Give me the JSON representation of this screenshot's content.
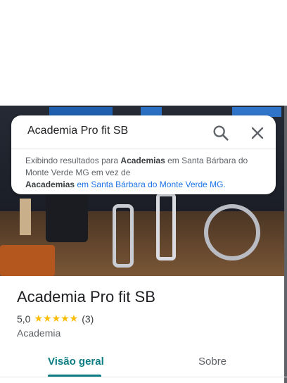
{
  "search": {
    "query": "Academia Pro fit SB",
    "notice_prefix": "Exibindo resultados para ",
    "notice_term": "Academias",
    "notice_middle": " em Santa Bárbara do Monte Verde MG em vez de",
    "alt_term": "Aacademias",
    "alt_rest": " em Santa Bárbara do Monte Verde MG."
  },
  "place": {
    "title": "Academia Pro fit SB",
    "rating": "5,0",
    "stars": "★★★★★",
    "stars_value": 5,
    "review_count": "(3)",
    "category": "Academia"
  },
  "tabs": [
    {
      "label": "Visão geral",
      "active": true
    },
    {
      "label": "Sobre",
      "active": false
    }
  ],
  "icons": {
    "search": "search-icon",
    "close": "close-icon"
  },
  "colors": {
    "accent": "#0b7d83",
    "star": "#fbbc04",
    "link": "#1a73e8"
  }
}
